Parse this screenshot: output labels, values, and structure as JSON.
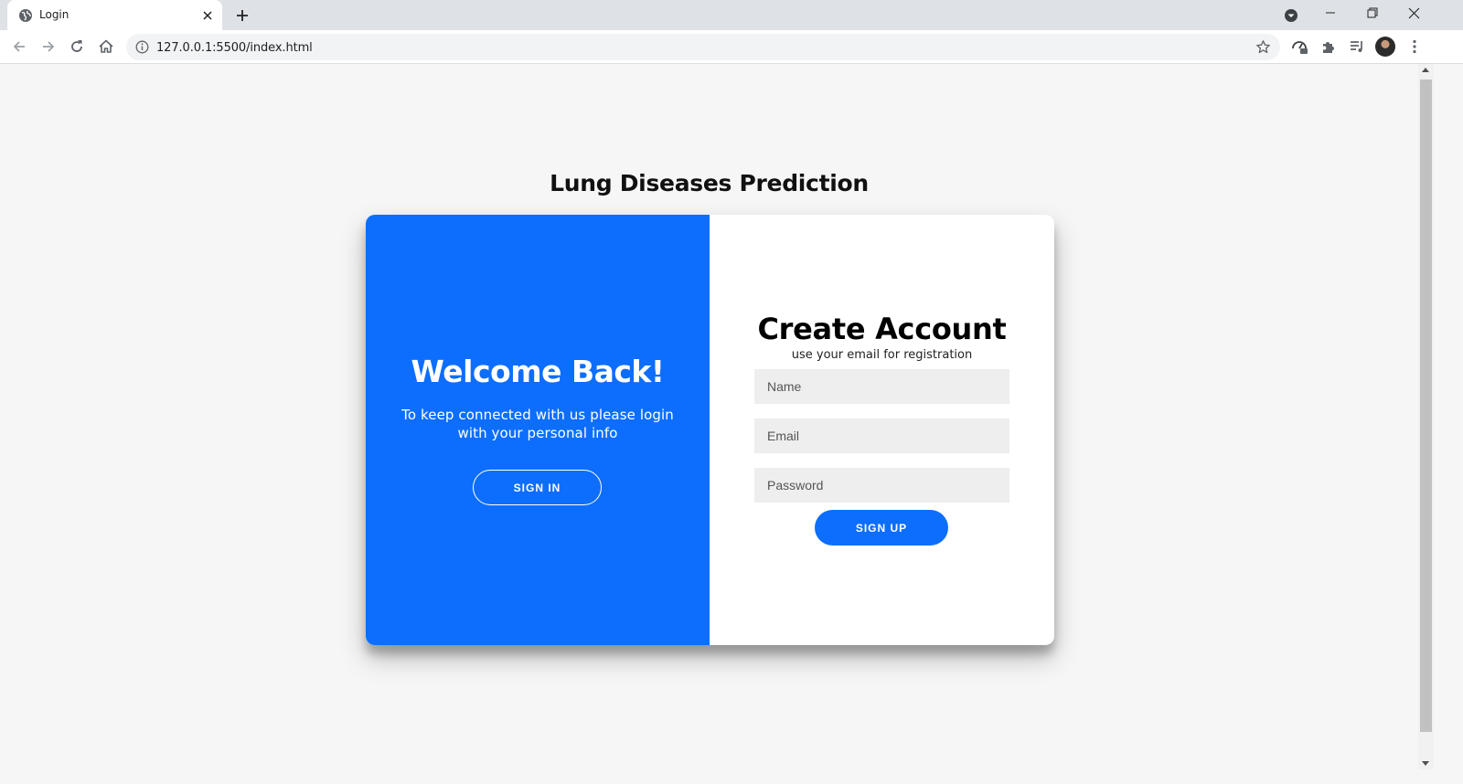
{
  "browser": {
    "tab_title": "Login",
    "url": "127.0.0.1:5500/index.html"
  },
  "page": {
    "title": "Lung Diseases Prediction"
  },
  "overlay": {
    "title": "Welcome Back!",
    "text": "To keep connected with us please login with your personal info",
    "button_label": "SIGN IN",
    "color": "#0d6efd"
  },
  "form": {
    "title": "Create Account",
    "subtitle": "use your email for registration",
    "name_placeholder": "Name",
    "email_placeholder": "Email",
    "password_placeholder": "Password",
    "button_label": "SIGN UP",
    "button_color": "#0d6efd"
  }
}
